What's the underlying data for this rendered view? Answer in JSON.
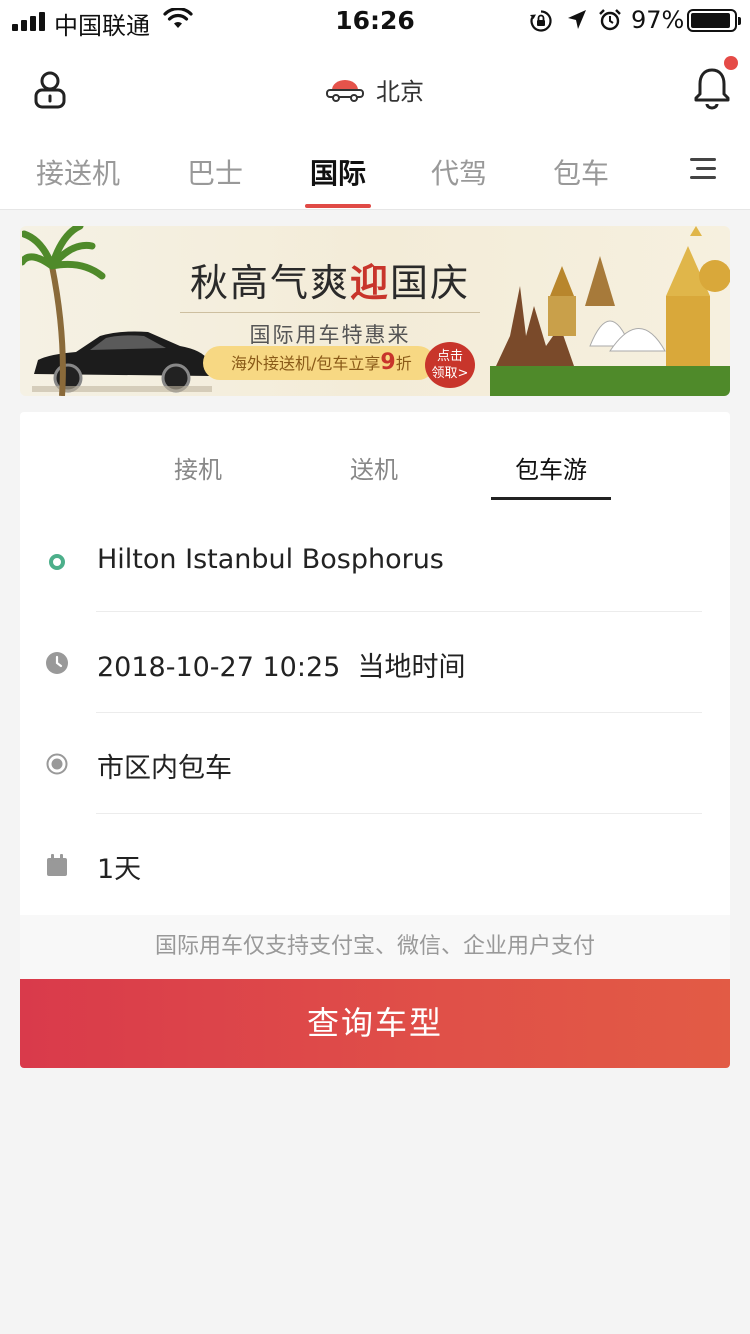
{
  "status_bar": {
    "carrier": "中国联通",
    "time": "16:26",
    "battery_pct": "97%",
    "icons": [
      "signal-icon",
      "wifi-icon",
      "rotation-lock-icon",
      "location-icon",
      "alarm-icon",
      "battery-icon"
    ]
  },
  "header": {
    "city": "北京",
    "icons": [
      "user-icon",
      "car-icon",
      "bell-icon"
    ],
    "notification_dot_color": "#e54b47"
  },
  "tabs": {
    "items": [
      "接送机",
      "巴士",
      "国际",
      "代驾",
      "包车"
    ],
    "active_index": 2,
    "accent": "#e04a46"
  },
  "banner": {
    "headline_pre": "秋高气爽",
    "headline_hl": "迎",
    "headline_post": "国庆",
    "subline": "国际用车特惠来",
    "promo_text": "海外接送机/包车立享",
    "promo_num": "9",
    "promo_unit": "折",
    "cta_line1": "点击",
    "cta_line2": "领取>"
  },
  "card": {
    "sub_tabs": [
      "接机",
      "送机",
      "包车游"
    ],
    "active_sub_tab": 2,
    "fields": {
      "location": "Hilton Istanbul Bosphorus",
      "datetime": "2018-10-27 10:25  当地时间",
      "service": "市区内包车",
      "duration": "1天"
    },
    "payment_note": "国际用车仅支持支付宝、微信、企业用户支付",
    "query_button": "查询车型"
  }
}
